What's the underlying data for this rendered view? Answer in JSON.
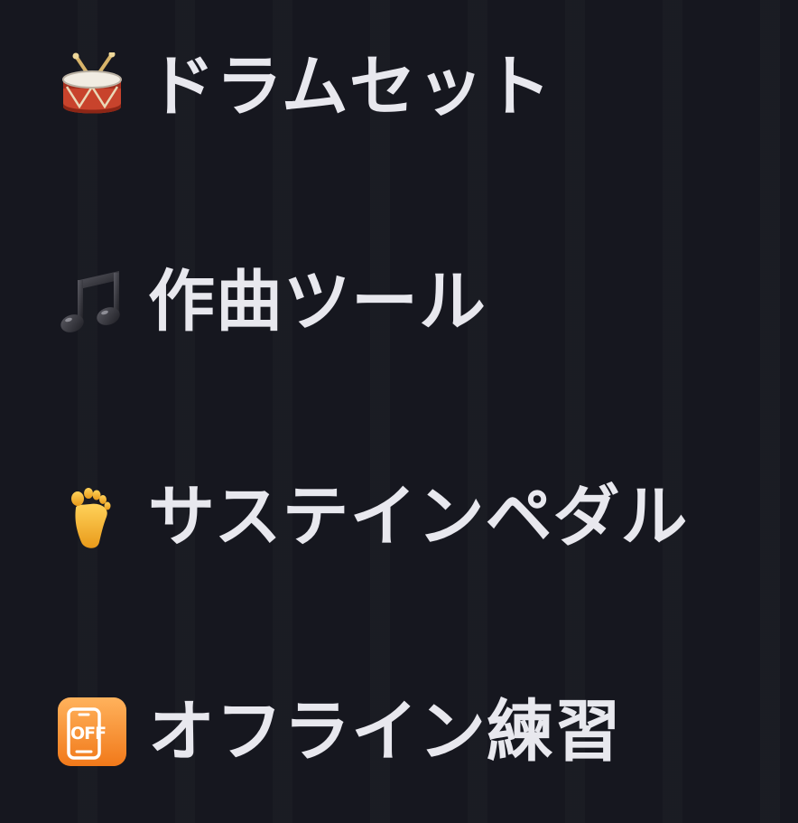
{
  "features": [
    {
      "icon": "drum-icon",
      "label": "ドラムセット"
    },
    {
      "icon": "musical-note-icon",
      "label": "作曲ツール"
    },
    {
      "icon": "foot-icon",
      "label": "サステインペダル"
    },
    {
      "icon": "phone-off-icon",
      "label": "オフライン練習",
      "badge": "OFF"
    }
  ]
}
